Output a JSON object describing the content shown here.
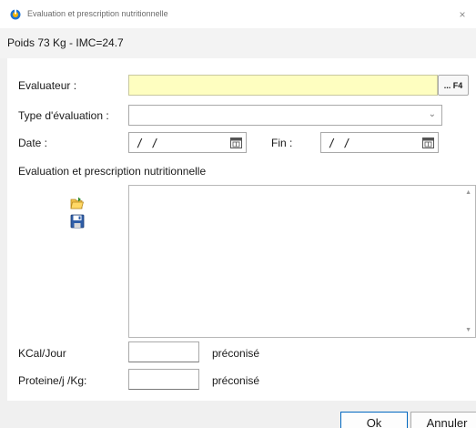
{
  "window": {
    "title": "Evaluation et prescription nutritionnelle",
    "close_glyph": "×"
  },
  "header": {
    "patient_info": "Poids 73 Kg - IMC=24.7"
  },
  "form": {
    "evaluateur_label": "Evaluateur :",
    "evaluateur_value": "",
    "lookup_button_label": "... F4",
    "type_label": "Type d'évaluation :",
    "type_value": "",
    "date_label": "Date :",
    "date_value": "/ /",
    "fin_label": "Fin :",
    "fin_value": "/ /",
    "section_label": "Evaluation et prescription nutritionnelle",
    "prescription_text": "",
    "kcal_label": "KCal/Jour",
    "kcal_value": "",
    "kcal_suffix": "préconisé",
    "proteine_label": "Proteine/j /Kg:",
    "proteine_value": "",
    "proteine_suffix": "préconisé"
  },
  "toolbar_icons": [
    "open-folder-icon",
    "save-disk-icon"
  ],
  "footer": {
    "ok_label": "Ok",
    "cancel_label": "Annuler"
  },
  "colors": {
    "required_field_bg": "#fefec0",
    "accent": "#0067c0"
  }
}
